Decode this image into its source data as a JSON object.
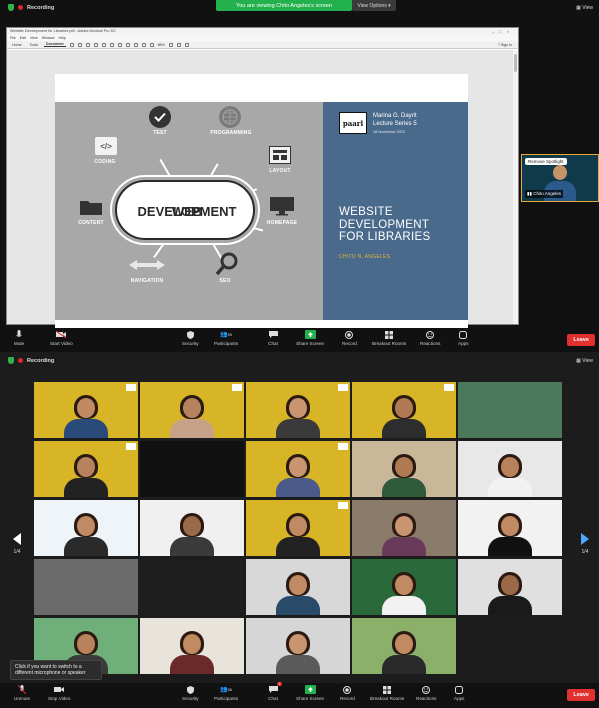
{
  "top_window": {
    "recording_label": "Recording",
    "banner_text": "You are viewing Chito Angeles's screen",
    "view_options_label": "View Options",
    "view_label": "View",
    "pdf": {
      "window_title": "Website Development for Libraries.pdf - Adobe Acrobat Pro DC",
      "menu": [
        "File",
        "Edit",
        "View",
        "Window",
        "Help"
      ],
      "tabs": [
        "Home",
        "Tools",
        "Document"
      ],
      "zoom_label": "66%",
      "signin_label": "Sign In"
    },
    "slide": {
      "logo_text": "paarl",
      "speaker_name": "Marina G. Dayrit",
      "lecture_series": "Lecture Series 5",
      "date": "18 November 2022",
      "title_lines": [
        "WEBSITE",
        "DEVELOPMENT",
        "FOR LIBRARIES"
      ],
      "author": "CHITO N. ANGELES",
      "center_text_lines": [
        "WEB",
        "DEVELOPMENT"
      ],
      "nodes": {
        "test": "TEST",
        "programming": "PROGRAMMING",
        "coding": "CODING",
        "layout": "LAYOUT",
        "content": "CONTENT",
        "homepage": "HOMEPAGE",
        "navigation": "NAVIGATION",
        "seo": "SEO"
      }
    },
    "spotlight": {
      "remove_label": "Remove Spotlight",
      "name": "Chito Angeles"
    },
    "controls": {
      "mute": "Mute",
      "start_video": "Start Video",
      "security": "Security",
      "participants": "Participants",
      "participants_count": "85",
      "chat": "Chat",
      "share_screen": "Share Screen",
      "record": "Record",
      "breakout": "Breakout Rooms",
      "reactions": "Reactions",
      "apps": "Apps",
      "leave": "Leave"
    }
  },
  "bottom_window": {
    "recording_label": "Recording",
    "view_label": "View",
    "page_left": "1/4",
    "page_right": "1/4",
    "tooltip": "Click if you want to switch to a different microphone or speaker",
    "controls": {
      "unmute": "Unmute",
      "stop_video": "Stop Video",
      "security": "Security",
      "participants": "Participants",
      "participants_count": "86",
      "chat": "Chat",
      "chat_badge": "1",
      "share_screen": "Share Screen",
      "record": "Record",
      "breakout": "Breakout Rooms",
      "reactions": "Reactions",
      "apps": "Apps",
      "leave": "Leave"
    },
    "colors": {
      "yellow_bg": "#d8b526",
      "active_border": "#7bd34d",
      "leave": "#e03030",
      "share_green": "#23b14d"
    }
  }
}
